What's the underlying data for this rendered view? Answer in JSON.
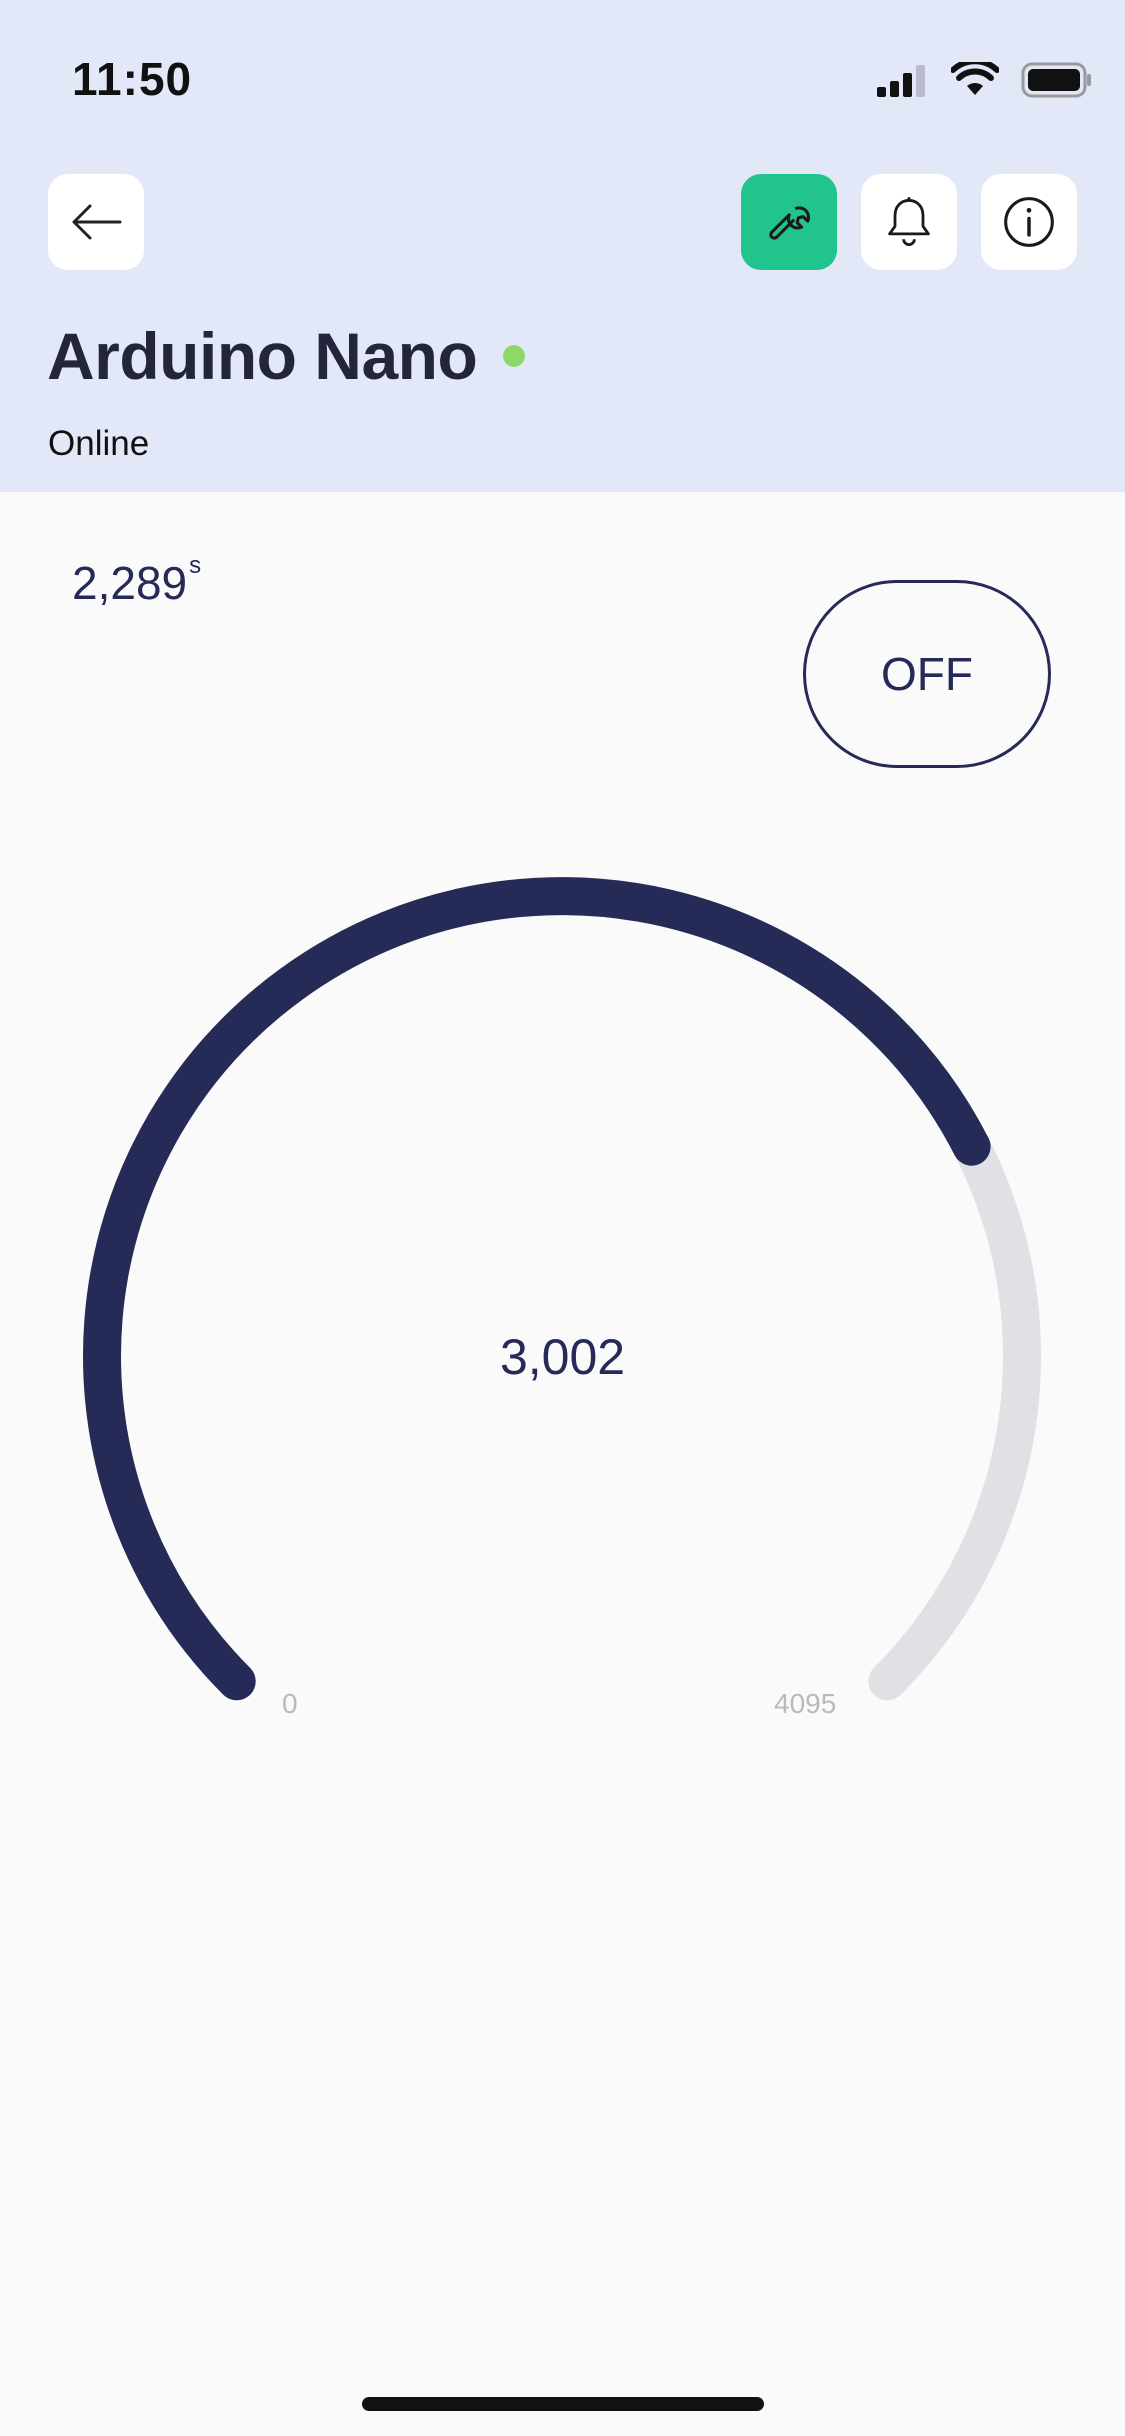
{
  "status_bar": {
    "time": "11:50"
  },
  "toolbar": {
    "back_icon": "arrow-left-icon",
    "tools": [
      {
        "name": "wrench",
        "icon": "wrench-icon",
        "active": true
      },
      {
        "name": "notifications",
        "icon": "bell-icon",
        "active": false
      },
      {
        "name": "info",
        "icon": "info-icon",
        "active": false
      }
    ]
  },
  "device": {
    "name": "Arduino Nano",
    "status": "Online",
    "status_color": "#8fd868"
  },
  "uptime": {
    "value": "2,289",
    "unit": "s"
  },
  "toggle": {
    "label": "OFF"
  },
  "gauge": {
    "value": 3002,
    "display_value": "3,002",
    "min": 0,
    "max": 4095,
    "min_label": "0",
    "max_label": "4095"
  },
  "colors": {
    "header_bg": "#e3e8f8",
    "accent": "#22c48e",
    "primary": "#262a57",
    "track": "#e0e1e4"
  }
}
